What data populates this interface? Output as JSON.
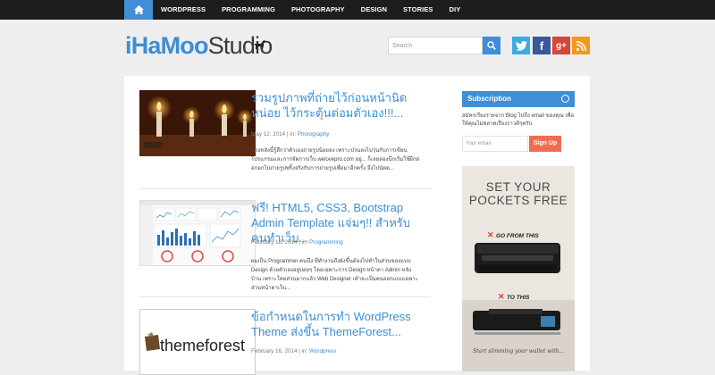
{
  "nav": {
    "home_icon": "home-icon",
    "items": [
      "WORDPRESS",
      "PROGRAMMING",
      "PHOTOGRAPHY",
      "DESIGN",
      "STORIES",
      "DIY"
    ]
  },
  "header": {
    "logo_brand": "iHaMoo",
    "logo_studio": "Studio",
    "search_placeholder": "Search",
    "social": [
      "twitter-icon",
      "facebook-icon",
      "google-plus-icon",
      "rss-icon"
    ]
  },
  "posts": [
    {
      "title": "รวมรูปภาพที่ถ่ายไว้ก่อนหน้านิดหน่อย ไว้กระตุ้นต่อมตัวเอง!!!...",
      "date": "May 12, 2014",
      "sep": " | in: ",
      "category": "Photography",
      "excerpt": "ช่วงหลังนี้รู้สึกว่าตัวเองถ่ายรูปน้อยลง เพราะป่วนลงไปวุ่นกับการเขียนโปรแกรมและการจัดการเว็บ welovepro.com อยู่... ก็เลยลองนึกเริ่มใช้ฝึกฝอกอกไปถ่ายรูปพริ้งจริงกับการถ่ายรูปเพื่อมาอีกครั้ง จึงไปนัดด..."
    },
    {
      "title": "ฟรี! HTML5, CSS3, Bootstrap Admin Template แจ่มๆ!! สำหรับคนทำเว็บ...",
      "date": "February 18, 2014",
      "sep": " | in: ",
      "category": "Programming",
      "excerpt": "ผมเป็น Programmer คนนึง ที่ทำงานถึงยังขึ้นต้องไปทำในส่วนของแบบ Design ด้วยตัวเองอยู่บ่อยๆ โดยเฉพาะการ Design หน้าตา Admin หลังบ้าน เพราะโดยส่วนมากแล้ว Web Designer เค้าจะเป็นคนออกแบบเฉพาะส่วนหน้าตาเว็บ..."
    },
    {
      "title": "ข้อกำหนดในการทำ WordPress Theme ส่งขึ้น ThemeForest...",
      "date": "February 16, 2014",
      "sep": " | in: ",
      "category": "Wordpress",
      "excerpt": ""
    }
  ],
  "thumb3_logo": "themeforest",
  "sidebar": {
    "subscription_title": "Subscription",
    "subscription_text": "สมัครเรียงรายจาก Blog ไปถึง email ของคุณ เพื่อให้คุณไม่พลาดเรื่องราวดีๆครับ",
    "email_placeholder": "Your email",
    "signup_label": "Sign Up",
    "ad": {
      "headline1": "SET YOUR",
      "headline2": "POCKETS FREE",
      "go_from": "GO FROM THIS",
      "to_this": "TO THIS",
      "slim": "Start slimming your wallet with..."
    }
  },
  "colors": {
    "accent": "#3f8ed6",
    "nav_bg": "#1d1d1d",
    "signup": "#f06d4f"
  }
}
